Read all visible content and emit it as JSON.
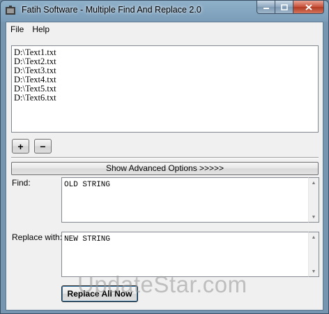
{
  "window": {
    "title": "Fatih Software - Multiple Find And Replace 2.0"
  },
  "menu": [
    {
      "label": "File"
    },
    {
      "label": "Help"
    }
  ],
  "files": [
    {
      "path": "D:\\Text1.txt"
    },
    {
      "path": "D:\\Text2.txt"
    },
    {
      "path": "D:\\Text3.txt"
    },
    {
      "path": "D:\\Text4.txt"
    },
    {
      "path": "D:\\Text5.txt"
    },
    {
      "path": "D:\\Text6.txt"
    }
  ],
  "buttons": {
    "add": "+",
    "remove": "−",
    "advanced": "Show Advanced Options >>>>>",
    "replace_all": "Replace All Now"
  },
  "find": {
    "label": "Find:",
    "value": "OLD STRING"
  },
  "replace": {
    "label": "Replace with:",
    "value": "NEW STRING"
  },
  "watermark": "UpdateStar.com"
}
